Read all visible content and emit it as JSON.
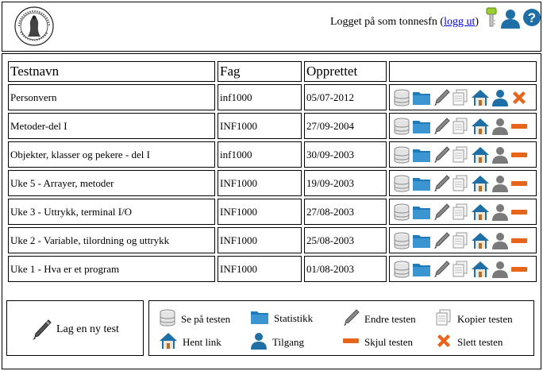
{
  "header": {
    "logged_in_prefix": "Logget på som tonnesfn (",
    "logout_label": "logg ut",
    "logged_in_suffix": ")"
  },
  "table": {
    "columns": [
      "Testnavn",
      "Fag",
      "Opprettet",
      ""
    ],
    "rows": [
      {
        "name": "Personvern",
        "subject": "inf1000",
        "created": "05/07-2012",
        "access_active": true,
        "hidden": false
      },
      {
        "name": "Metoder-del I",
        "subject": "INF1000",
        "created": "27/09-2004",
        "access_active": false,
        "hidden": true
      },
      {
        "name": "Objekter, klasser og pekere - del I",
        "subject": "inf1000",
        "created": "30/09-2003",
        "access_active": false,
        "hidden": true
      },
      {
        "name": "Uke 5 - Arrayer, metoder",
        "subject": "INF1000",
        "created": "19/09-2003",
        "access_active": false,
        "hidden": true
      },
      {
        "name": "Uke 3 - Uttrykk, terminal I/O",
        "subject": "INF1000",
        "created": "27/08-2003",
        "access_active": false,
        "hidden": true
      },
      {
        "name": "Uke 2 - Variable, tilordning og uttrykk",
        "subject": "INF1000",
        "created": "25/08-2003",
        "access_active": false,
        "hidden": true
      },
      {
        "name": "Uke 1 - Hva er et program",
        "subject": "INF1000",
        "created": "01/08-2003",
        "access_active": false,
        "hidden": true
      }
    ]
  },
  "new_test": {
    "label": "Lag en ny test"
  },
  "legend": {
    "view": "Se på testen",
    "stats": "Statistikk",
    "edit": "Endre testen",
    "copy": "Kopier testen",
    "link": "Hent link",
    "access": "Tilgang",
    "hide": "Skjul testen",
    "delete": "Slett testen"
  },
  "colors": {
    "link": "#0000ee",
    "folder": "#1f7ab8",
    "user_active": "#1d6fa5",
    "user_inactive": "#7a7a7a",
    "hide_bar": "#e8641a",
    "delete_x": "#e8641a",
    "help": "#1d6fa5",
    "key": "#9acd32"
  }
}
